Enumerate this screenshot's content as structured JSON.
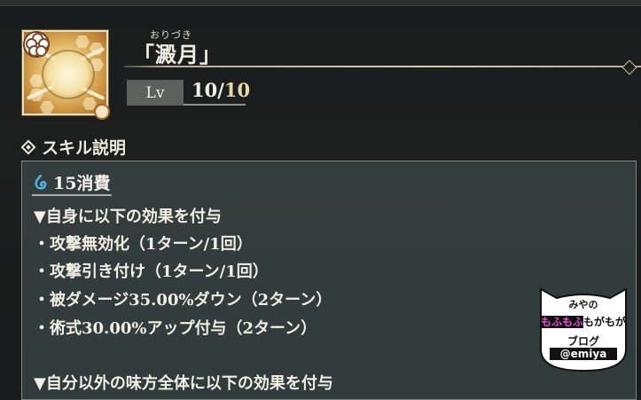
{
  "skill": {
    "furigana": "おりづき",
    "name": "「澱月」",
    "level_label": "Lv",
    "level_current": "10",
    "level_separator": "/",
    "level_max": "10"
  },
  "section": {
    "title": "スキル説明"
  },
  "description": {
    "cost": "15消費",
    "lines": [
      "▼自身に以下の効果を付与",
      "・攻撃無効化（1ターン/1回）",
      "・攻撃引き付け（1ターン/1回）",
      "・被ダメージ35.00%ダウン（2ターン）",
      "・術式30.00%アップ付与（2ターン）",
      "",
      "▼自分以外の味方全体に以下の効果を付与"
    ]
  },
  "watermark": {
    "line1": "みやの",
    "line2a": "もふもふ",
    "line2b": "もがもが",
    "line3": "ブログ",
    "handle": "@emiya"
  },
  "icons": {
    "skill_icon": "orizuki-skill-icon",
    "badge": "flower-badge-icon",
    "cost": "cursed-energy-flame-icon",
    "section": "diamond-icon"
  },
  "colors": {
    "panel": "#343d3d",
    "accent_gold": "#e7d9a6",
    "mana_blue": "#4fb6e8",
    "watermark_pink": "#e84fd8"
  }
}
